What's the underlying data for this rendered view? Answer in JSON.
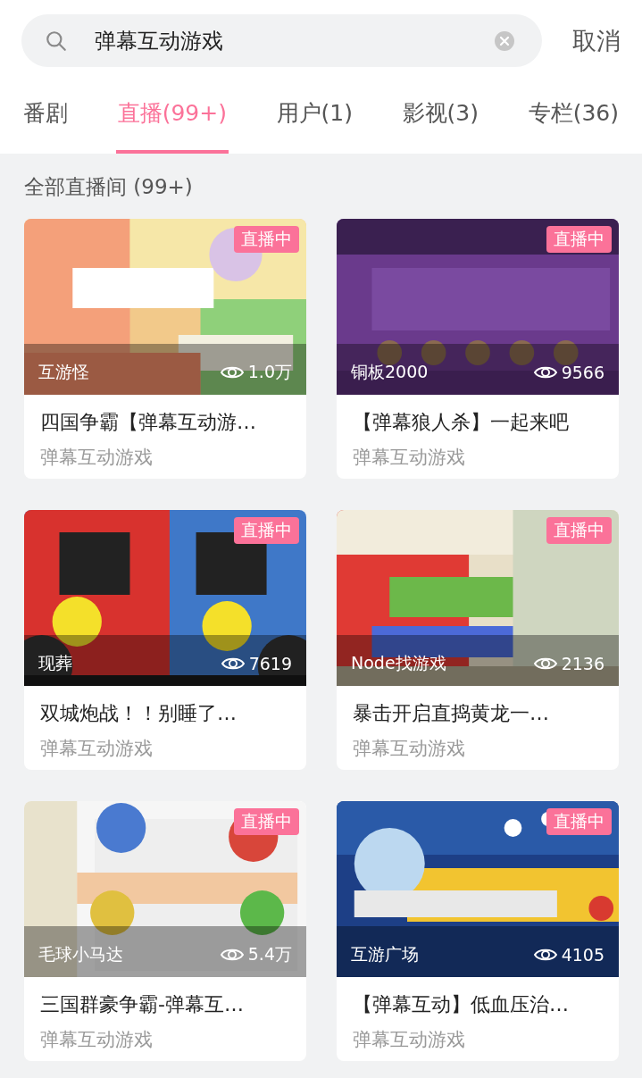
{
  "search": {
    "value": "弹幕互动游戏",
    "cancel": "取消"
  },
  "tabs": [
    {
      "label": "番剧",
      "selected": false
    },
    {
      "label": "直播(99+)",
      "selected": true
    },
    {
      "label": "用户(1)",
      "selected": false
    },
    {
      "label": "影视(3)",
      "selected": false
    },
    {
      "label": "专栏(36)",
      "selected": false
    }
  ],
  "section_title": "全部直播间 (99+)",
  "cards": [
    {
      "badge": "直播中",
      "streamer": "互游怪",
      "views": "1.0万",
      "title": "四国争霸【弹幕互动游…",
      "category": "弹幕互动游戏"
    },
    {
      "badge": "直播中",
      "streamer": "铜板2000",
      "views": "9566",
      "title": "【弹幕狼人杀】一起来吧",
      "category": "弹幕互动游戏"
    },
    {
      "badge": "直播中",
      "streamer": "现葬",
      "views": "7619",
      "title": "双城炮战！！别睡了…",
      "category": "弹幕互动游戏"
    },
    {
      "badge": "直播中",
      "streamer": "Node找游戏",
      "views": "2136",
      "title": "暴击开启直捣黄龙一…",
      "category": "弹幕互动游戏"
    },
    {
      "badge": "直播中",
      "streamer": "毛球小马达",
      "views": "5.4万",
      "title": "三国群豪争霸-弹幕互…",
      "category": "弹幕互动游戏"
    },
    {
      "badge": "直播中",
      "streamer": "互游广场",
      "views": "4105",
      "title": "【弹幕互动】低血压治…",
      "category": "弹幕互动游戏"
    }
  ]
}
